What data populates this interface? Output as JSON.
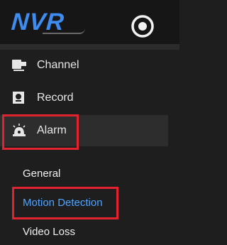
{
  "brand": {
    "logo_text": "NVR"
  },
  "header": {
    "settings_icon": "circle-settings-icon"
  },
  "menu": {
    "items": [
      {
        "label": "Channel",
        "icon": "camera-icon"
      },
      {
        "label": "Record",
        "icon": "record-icon"
      },
      {
        "label": "Alarm",
        "icon": "alarm-icon"
      }
    ],
    "submenu": [
      {
        "label": "General",
        "active": false
      },
      {
        "label": "Motion Detection",
        "active": true
      },
      {
        "label": "Video Loss",
        "active": false
      }
    ]
  },
  "colors": {
    "background": "#1e1e1e",
    "accent": "#4fa3ff",
    "highlight_border": "#e0232e",
    "logo": "#3f8cf0"
  }
}
